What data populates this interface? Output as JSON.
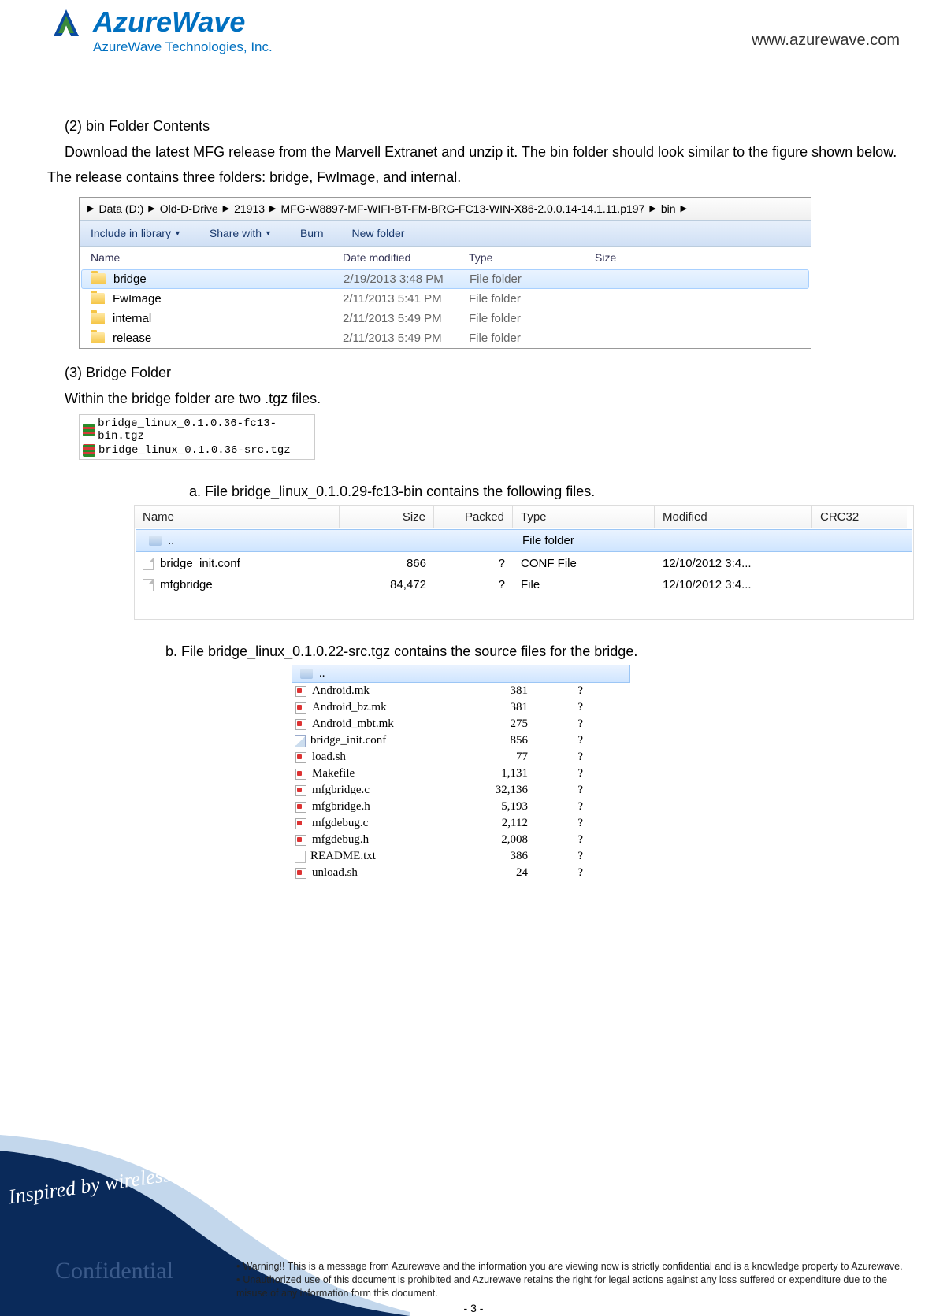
{
  "header": {
    "logo_name": "AzureWave",
    "logo_sub": "AzureWave  Technologies,  Inc.",
    "url": "www.azurewave.com"
  },
  "section2": {
    "title": "(2) bin Folder Contents",
    "text": "Download the latest MFG release from the Marvell Extranet and unzip it. The bin folder should look similar to   the figure shown below. The release contains three folders: bridge, FwImage, and internal."
  },
  "explorer": {
    "path": [
      "Data (D:)",
      "Old-D-Drive",
      "21913",
      "MFG-W8897-MF-WIFI-BT-FM-BRG-FC13-WIN-X86-2.0.0.14-14.1.11.p197",
      "bin"
    ],
    "toolbar": {
      "include": "Include in library",
      "share": "Share with",
      "burn": "Burn",
      "newfolder": "New folder"
    },
    "headers": {
      "name": "Name",
      "date": "Date modified",
      "type": "Type",
      "size": "Size"
    },
    "rows": [
      {
        "name": "bridge",
        "date": "2/19/2013 3:48 PM",
        "type": "File folder",
        "selected": true
      },
      {
        "name": "FwImage",
        "date": "2/11/2013 5:41 PM",
        "type": "File folder"
      },
      {
        "name": "internal",
        "date": "2/11/2013 5:49 PM",
        "type": "File folder"
      },
      {
        "name": "release",
        "date": "2/11/2013 5:49 PM",
        "type": "File folder"
      }
    ]
  },
  "section3": {
    "title": "(3) Bridge Folder",
    "text": "Within the bridge folder are two .tgz files."
  },
  "tgz_files": [
    "bridge_linux_0.1.0.36-fc13-bin.tgz",
    "bridge_linux_0.1.0.36-src.tgz"
  ],
  "caption_a": "a. File bridge_linux_0.1.0.29-fc13-bin contains the following files.",
  "archive1": {
    "headers": {
      "name": "Name",
      "size": "Size",
      "packed": "Packed",
      "type": "Type",
      "mod": "Modified",
      "crc": "CRC32"
    },
    "parent": {
      "name": "..",
      "type": "File folder"
    },
    "rows": [
      {
        "name": "bridge_init.conf",
        "size": "866",
        "packed": "?",
        "type": "CONF File",
        "mod": "12/10/2012 3:4..."
      },
      {
        "name": "mfgbridge",
        "size": "84,472",
        "packed": "?",
        "type": "File",
        "mod": "12/10/2012 3:4..."
      }
    ]
  },
  "caption_b": "b. File bridge_linux_0.1.0.22-src.tgz contains the source files for the bridge.",
  "archive2": {
    "parent": "..",
    "rows": [
      {
        "name": "Android.mk",
        "size": "381",
        "packed": "?",
        "icon": "mk"
      },
      {
        "name": "Android_bz.mk",
        "size": "381",
        "packed": "?",
        "icon": "mk"
      },
      {
        "name": "Android_mbt.mk",
        "size": "275",
        "packed": "?",
        "icon": "mk"
      },
      {
        "name": "bridge_init.conf",
        "size": "856",
        "packed": "?",
        "icon": "conf"
      },
      {
        "name": "load.sh",
        "size": "77",
        "packed": "?",
        "icon": "mk"
      },
      {
        "name": "Makefile",
        "size": "1,131",
        "packed": "?",
        "icon": "mk"
      },
      {
        "name": "mfgbridge.c",
        "size": "32,136",
        "packed": "?",
        "icon": "mk"
      },
      {
        "name": "mfgbridge.h",
        "size": "5,193",
        "packed": "?",
        "icon": "mk"
      },
      {
        "name": "mfgdebug.c",
        "size": "2,112",
        "packed": "?",
        "icon": "mk"
      },
      {
        "name": "mfgdebug.h",
        "size": "2,008",
        "packed": "?",
        "icon": "mk"
      },
      {
        "name": "README.txt",
        "size": "386",
        "packed": "?",
        "icon": "txt"
      },
      {
        "name": "unload.sh",
        "size": "24",
        "packed": "?",
        "icon": "mk"
      }
    ]
  },
  "footer": {
    "slogan": "Inspired by wireless",
    "confidential": "Confidential",
    "warn1": "Warning!! This is a message from Azurewave and the information you are viewing now is strictly confidential and is a knowledge property to Azurewave.",
    "warn2": "Unauthorized use of this document is prohibited and Azurewave retains the right for legal actions against any loss suffered or expenditure due to the misuse of any information form this document.",
    "pagenum": "- 3 -"
  }
}
